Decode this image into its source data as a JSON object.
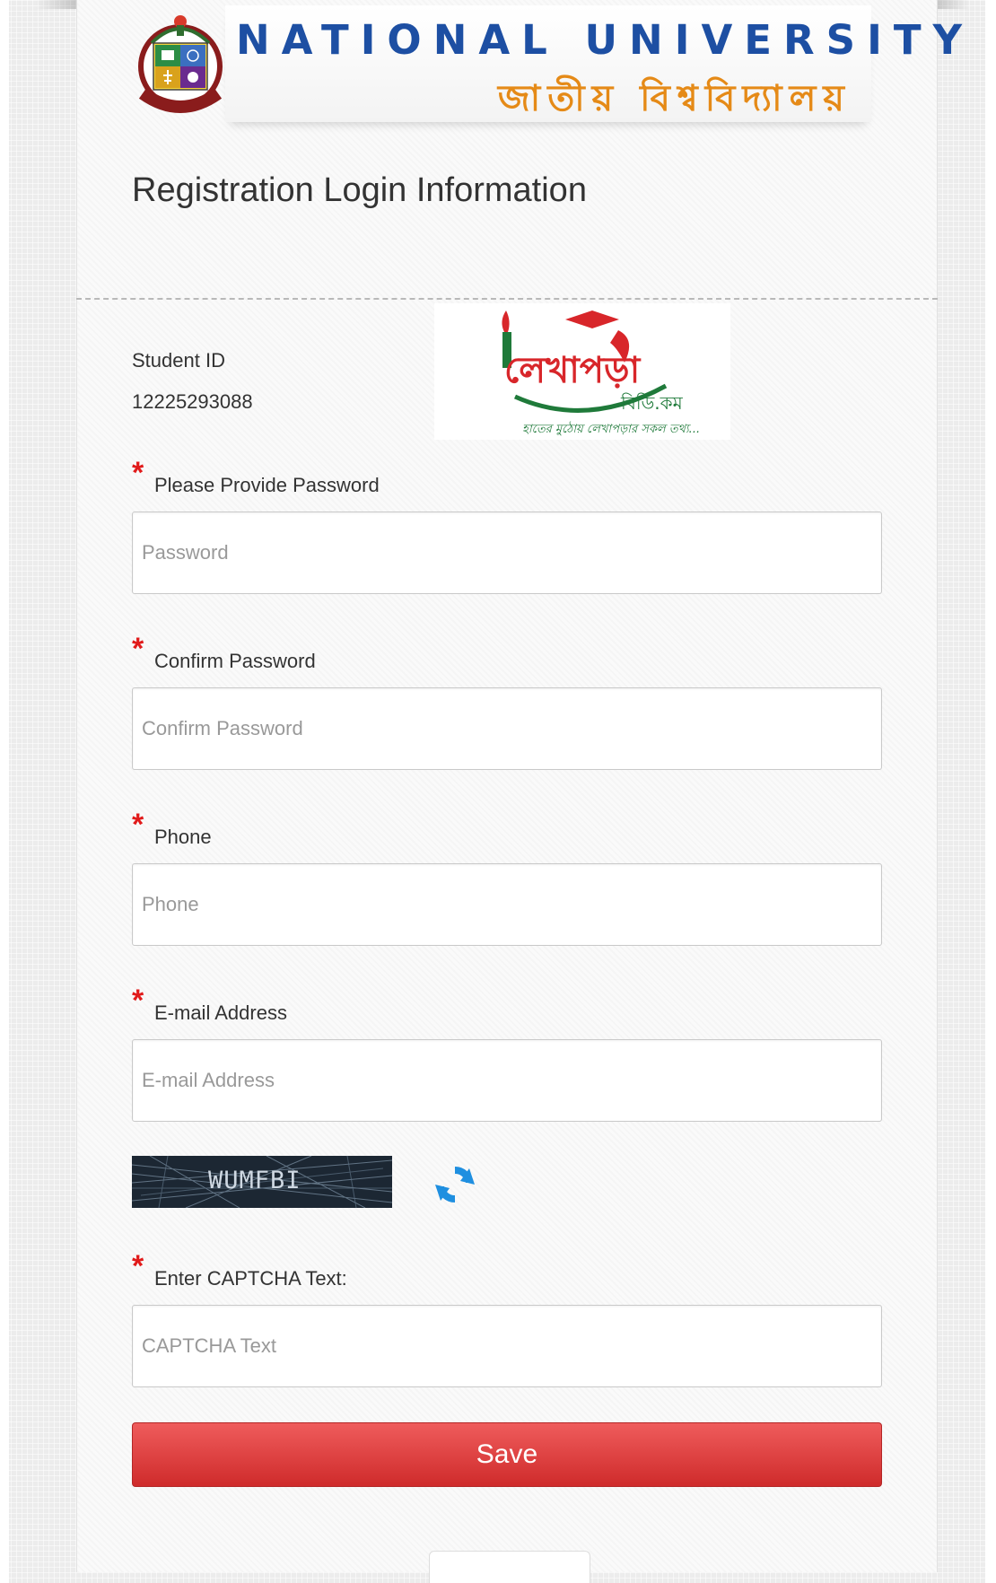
{
  "header": {
    "university_name_en": "NATIONAL UNIVERSITY",
    "university_name_bn": "জাতীয় বিশ্ববিদ্যালয়",
    "seal_icon": "national-university-seal-icon"
  },
  "page": {
    "title": "Registration Login Information"
  },
  "student": {
    "id_label": "Student ID",
    "id_value": "12225293088"
  },
  "sponsor_logo": {
    "icon": "lekhapora-bd-logo",
    "text_main": "লেখাপড়া",
    "text_domain": "বিডি.কম",
    "tagline": "হাতের মুঠোয় লেখাপড়ার সকল তথ্য..."
  },
  "form": {
    "required_mark": "*",
    "password": {
      "label": "Please Provide Password",
      "placeholder": "Password",
      "value": ""
    },
    "confirm_password": {
      "label": "Confirm Password",
      "placeholder": "Confirm Password",
      "value": ""
    },
    "phone": {
      "label": "Phone",
      "placeholder": "Phone",
      "value": ""
    },
    "email": {
      "label": "E-mail Address",
      "placeholder": "E-mail Address",
      "value": ""
    },
    "captcha": {
      "image_text": "WUMFBI",
      "refresh_icon": "refresh-icon",
      "label": "Enter CAPTCHA Text:",
      "placeholder": "CAPTCHA Text",
      "value": ""
    },
    "save_label": "Save"
  },
  "colors": {
    "brand_blue": "#1d4fa3",
    "brand_orange": "#e58a17",
    "required_red": "#e11b1b",
    "button_red": "#cf2b2b",
    "refresh_blue": "#1f8fe0"
  }
}
